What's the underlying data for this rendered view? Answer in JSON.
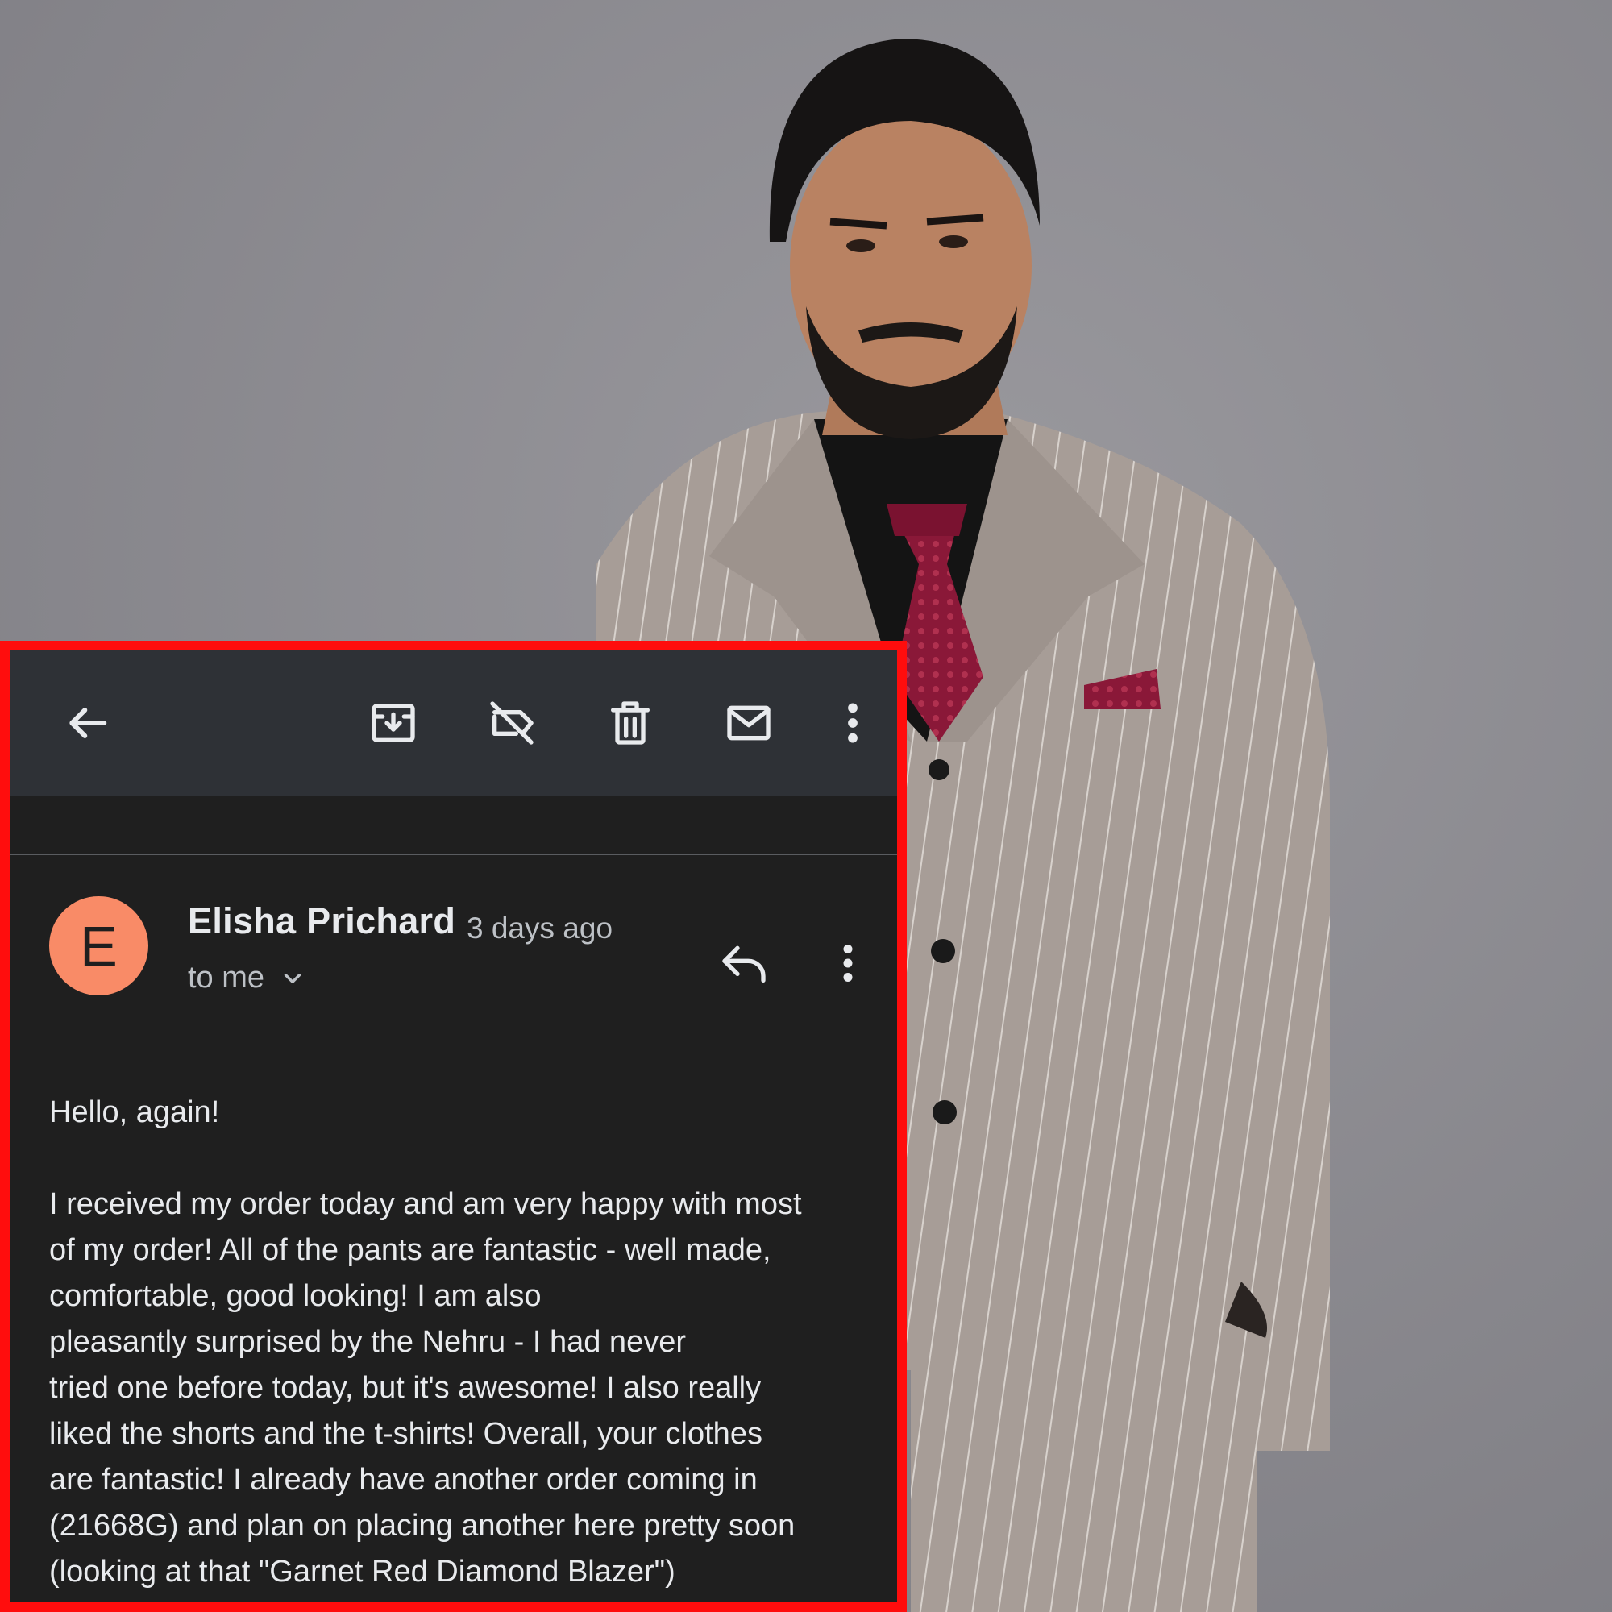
{
  "toolbar": {
    "back_icon": "arrow-left-icon",
    "archive_icon": "archive-icon",
    "label_off_icon": "label-off-icon",
    "delete_icon": "trash-icon",
    "mark_unread_icon": "mail-icon",
    "more_icon": "more-vertical-icon"
  },
  "message": {
    "avatar_letter": "E",
    "avatar_color": "#f98b67",
    "sender": "Elisha Prichard",
    "time": "3 days ago",
    "to": "to me",
    "greeting": "Hello, again!",
    "body_lines": [
      "I received my order today and am very happy with most",
      "of my order! All of the pants are fantastic - well made,",
      "comfortable, good looking! I am also",
      "pleasantly surprised by the Nehru - I had never",
      "tried one before today, but it's awesome! I also really",
      "liked the shorts and the t-shirts! Overall, your clothes",
      "are fantastic! I already have another order coming in",
      "(21668G) and plan on placing another here pretty soon",
      "(looking at that \"Garnet Red Diamond Blazer\")"
    ]
  },
  "colors": {
    "card_border": "#ff0d0d",
    "card_bg": "#1f1f1f",
    "toolbar_bg": "#2e3136",
    "text_primary": "#e8eaed",
    "text_secondary": "#bdc1c6"
  }
}
